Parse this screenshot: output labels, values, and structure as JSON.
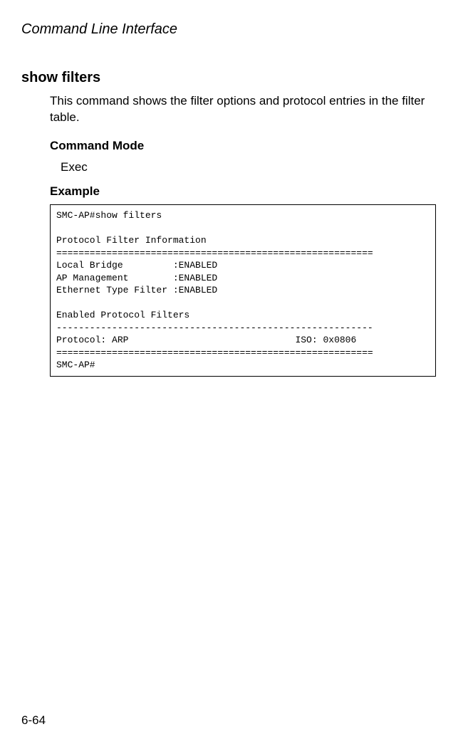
{
  "header": {
    "title": "Command Line Interface"
  },
  "section": {
    "title": "show filters",
    "description": "This command shows the filter options and protocol entries in the filter table.",
    "commandModeLabel": "Command Mode",
    "commandMode": "Exec",
    "exampleLabel": "Example"
  },
  "code": {
    "content": "SMC-AP#show filters\n\nProtocol Filter Information\n=========================================================\nLocal Bridge         :ENABLED\nAP Management        :ENABLED\nEthernet Type Filter :ENABLED\n\nEnabled Protocol Filters\n---------------------------------------------------------\nProtocol: ARP                              ISO: 0x0806\n=========================================================\nSMC-AP#"
  },
  "footer": {
    "pageNumber": "6-64"
  }
}
